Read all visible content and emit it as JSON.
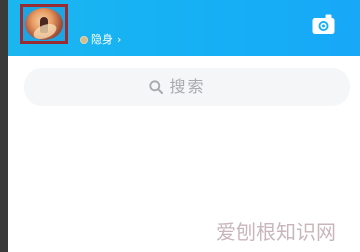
{
  "status": {
    "text": "隐身",
    "arrow": "›"
  },
  "search": {
    "label": "搜索"
  },
  "watermark": {
    "text": "爱刨根知识网"
  },
  "icons": {
    "status": "status-dot-icon",
    "camera": "camera-icon",
    "search": "search-icon"
  },
  "colors": {
    "header": "#16B1F3",
    "avatar_frame": "#9A2B33",
    "search_background": "#F4F6F8",
    "search_text": "#A7A9AD",
    "watermark": "#C8B6BB"
  }
}
